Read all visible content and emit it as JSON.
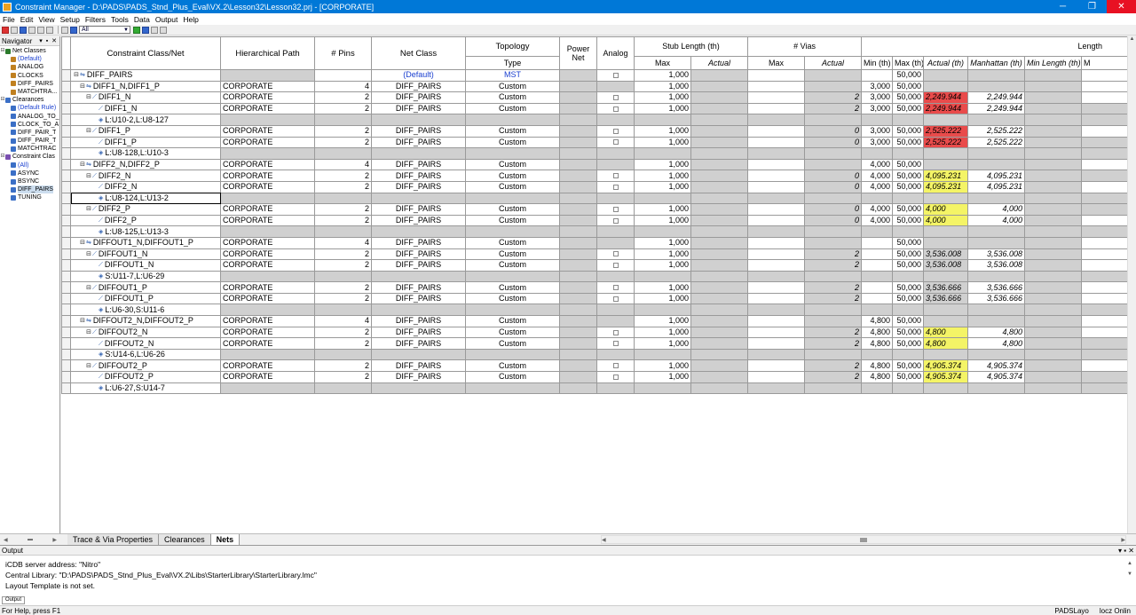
{
  "window": {
    "title": "Constraint Manager - D:\\PADS\\PADS_Stnd_Plus_Eval\\VX.2\\Lesson32\\Lesson32.prj - [CORPORATE]",
    "minimize": "─",
    "maximize": "❐",
    "close": "✕"
  },
  "menu": [
    "File",
    "Edit",
    "View",
    "Setup",
    "Filters",
    "Tools",
    "Data",
    "Output",
    "Help"
  ],
  "toolbar": {
    "filter_value": "All"
  },
  "navigator": {
    "title": "Navigator",
    "pin": "▾ ▪ ✕",
    "items": [
      {
        "label": "Net Classes",
        "level": 0,
        "exp": "⊟",
        "color": "#2b7a2b"
      },
      {
        "label": "(Default)",
        "level": 1,
        "exp": "",
        "color": "#c08020",
        "blue": true
      },
      {
        "label": "ANALOG",
        "level": 1,
        "exp": "",
        "color": "#c08020"
      },
      {
        "label": "CLOCKS",
        "level": 1,
        "exp": "",
        "color": "#c08020"
      },
      {
        "label": "DIFF_PAIRS",
        "level": 1,
        "exp": "",
        "color": "#c08020"
      },
      {
        "label": "MATCHTRA...",
        "level": 1,
        "exp": "",
        "color": "#c08020"
      },
      {
        "label": "Clearances",
        "level": 0,
        "exp": "⊟",
        "color": "#3b6fc6"
      },
      {
        "label": "(Default Rule)",
        "level": 1,
        "exp": "",
        "color": "#3b6fc6",
        "blue": true
      },
      {
        "label": "ANALOG_TO_",
        "level": 1,
        "exp": "",
        "color": "#3b6fc6"
      },
      {
        "label": "CLOCK_TO_A",
        "level": 1,
        "exp": "",
        "color": "#3b6fc6"
      },
      {
        "label": "DIFF_PAIR_T",
        "level": 1,
        "exp": "",
        "color": "#3b6fc6"
      },
      {
        "label": "DIFF_PAIR_T",
        "level": 1,
        "exp": "",
        "color": "#3b6fc6"
      },
      {
        "label": "MATCHTRAC",
        "level": 1,
        "exp": "",
        "color": "#3b6fc6"
      },
      {
        "label": "Constraint Clas",
        "level": 0,
        "exp": "⊟",
        "color": "#7a4fb0"
      },
      {
        "label": "(All)",
        "level": 1,
        "exp": "",
        "color": "#3b6fc6",
        "blue": true
      },
      {
        "label": "ASYNC",
        "level": 1,
        "exp": "",
        "color": "#3b6fc6"
      },
      {
        "label": "BSYNC",
        "level": 1,
        "exp": "",
        "color": "#3b6fc6"
      },
      {
        "label": "DIFF_PAIRS",
        "level": 1,
        "exp": "",
        "color": "#3b6fc6",
        "sel": true
      },
      {
        "label": "TUNING",
        "level": 1,
        "exp": "",
        "color": "#3b6fc6"
      }
    ]
  },
  "headers": {
    "name": "Constraint Class/Net",
    "hier": "Hierarchical Path",
    "pins": "# Pins",
    "netclass": "Net Class",
    "topology": "Topology",
    "type": "Type",
    "power": "Power Net",
    "analog": "Analog",
    "stub": "Stub Length (th)",
    "stub_max": "Max",
    "stub_actual": "Actual",
    "vias": "# Vias",
    "vias_max": "Max",
    "vias_actual": "Actual",
    "length": "Length",
    "len_min": "Min (th)",
    "len_max": "Max (th)",
    "len_actual": "Actual (th)",
    "len_manhattan": "Manhattan (th)",
    "len_minlen": "Min Length (th)",
    "len_more": "M"
  },
  "rows": [
    {
      "name": "DIFF_PAIRS",
      "indent": 0,
      "exp": "⊟",
      "icon": "⇋",
      "kind": "class",
      "hier": "",
      "pins": "",
      "netclass": "(Default)",
      "type": "MST",
      "analog": false,
      "stub": "1,000",
      "vact": "",
      "min": "",
      "max": "50,000",
      "actual": "",
      "man": "",
      "status": ""
    },
    {
      "name": "DIFF1_N,DIFF1_P",
      "indent": 1,
      "exp": "⊟",
      "icon": "⇋",
      "kind": "pair",
      "hier": "CORPORATE",
      "pins": "4",
      "netclass": "DIFF_PAIRS",
      "type": "Custom",
      "analog": null,
      "stub": "1,000",
      "vact": "",
      "min": "3,000",
      "max": "50,000",
      "actual": "",
      "man": "",
      "status": ""
    },
    {
      "name": "DIFF1_N",
      "indent": 2,
      "exp": "⊟",
      "icon": "⟋",
      "kind": "net",
      "hier": "CORPORATE",
      "pins": "2",
      "netclass": "DIFF_PAIRS",
      "type": "Custom",
      "analog": false,
      "stub": "1,000",
      "vact": "2",
      "min": "3,000",
      "max": "50,000",
      "actual": "2,249.944",
      "man": "2,249.944",
      "status": "fail"
    },
    {
      "name": "DIFF1_N",
      "indent": 3,
      "exp": "",
      "icon": "⟋",
      "kind": "net",
      "hier": "CORPORATE",
      "pins": "2",
      "netclass": "DIFF_PAIRS",
      "type": "Custom",
      "analog": false,
      "stub": "1,000",
      "vact": "2",
      "min": "3,000",
      "max": "50,000",
      "actual": "2,249.944",
      "man": "2,249.944",
      "status": "fail"
    },
    {
      "name": "L:U10-2,L:U8-127",
      "indent": 3,
      "exp": "",
      "icon": "◈",
      "kind": "pinpair"
    },
    {
      "name": "DIFF1_P",
      "indent": 2,
      "exp": "⊟",
      "icon": "⟋",
      "kind": "net",
      "hier": "CORPORATE",
      "pins": "2",
      "netclass": "DIFF_PAIRS",
      "type": "Custom",
      "analog": false,
      "stub": "1,000",
      "vact": "0",
      "min": "3,000",
      "max": "50,000",
      "actual": "2,525.222",
      "man": "2,525.222",
      "status": "fail"
    },
    {
      "name": "DIFF1_P",
      "indent": 3,
      "exp": "",
      "icon": "⟋",
      "kind": "net",
      "hier": "CORPORATE",
      "pins": "2",
      "netclass": "DIFF_PAIRS",
      "type": "Custom",
      "analog": false,
      "stub": "1,000",
      "vact": "0",
      "min": "3,000",
      "max": "50,000",
      "actual": "2,525.222",
      "man": "2,525.222",
      "status": "fail"
    },
    {
      "name": "L:U8-128,L:U10-3",
      "indent": 3,
      "exp": "",
      "icon": "◈",
      "kind": "pinpair"
    },
    {
      "name": "DIFF2_N,DIFF2_P",
      "indent": 1,
      "exp": "⊟",
      "icon": "⇋",
      "kind": "pair",
      "hier": "CORPORATE",
      "pins": "4",
      "netclass": "DIFF_PAIRS",
      "type": "Custom",
      "analog": null,
      "stub": "1,000",
      "vact": "",
      "min": "4,000",
      "max": "50,000",
      "actual": "",
      "man": "",
      "status": ""
    },
    {
      "name": "DIFF2_N",
      "indent": 2,
      "exp": "⊟",
      "icon": "⟋",
      "kind": "net",
      "hier": "CORPORATE",
      "pins": "2",
      "netclass": "DIFF_PAIRS",
      "type": "Custom",
      "analog": false,
      "stub": "1,000",
      "vact": "0",
      "min": "4,000",
      "max": "50,000",
      "actual": "4,095.231",
      "man": "4,095.231",
      "status": "warn"
    },
    {
      "name": "DIFF2_N",
      "indent": 3,
      "exp": "",
      "icon": "⟋",
      "kind": "net",
      "hier": "CORPORATE",
      "pins": "2",
      "netclass": "DIFF_PAIRS",
      "type": "Custom",
      "analog": false,
      "stub": "1,000",
      "vact": "0",
      "min": "4,000",
      "max": "50,000",
      "actual": "4,095.231",
      "man": "4,095.231",
      "status": "warn"
    },
    {
      "name": "L:U8-124,L:U13-2",
      "indent": 3,
      "exp": "",
      "icon": "◈",
      "kind": "pinpair",
      "selected": true
    },
    {
      "name": "DIFF2_P",
      "indent": 2,
      "exp": "⊟",
      "icon": "⟋",
      "kind": "net",
      "hier": "CORPORATE",
      "pins": "2",
      "netclass": "DIFF_PAIRS",
      "type": "Custom",
      "analog": false,
      "stub": "1,000",
      "vact": "0",
      "min": "4,000",
      "max": "50,000",
      "actual": "4,000",
      "man": "4,000",
      "status": "warn"
    },
    {
      "name": "DIFF2_P",
      "indent": 3,
      "exp": "",
      "icon": "⟋",
      "kind": "net",
      "hier": "CORPORATE",
      "pins": "2",
      "netclass": "DIFF_PAIRS",
      "type": "Custom",
      "analog": false,
      "stub": "1,000",
      "vact": "0",
      "min": "4,000",
      "max": "50,000",
      "actual": "4,000",
      "man": "4,000",
      "status": "warn"
    },
    {
      "name": "L:U8-125,L:U13-3",
      "indent": 3,
      "exp": "",
      "icon": "◈",
      "kind": "pinpair"
    },
    {
      "name": "DIFFOUT1_N,DIFFOUT1_P",
      "indent": 1,
      "exp": "⊟",
      "icon": "⇋",
      "kind": "pair",
      "hier": "CORPORATE",
      "pins": "4",
      "netclass": "DIFF_PAIRS",
      "type": "Custom",
      "analog": null,
      "stub": "1,000",
      "vact": "",
      "min": "",
      "max": "50,000",
      "actual": "",
      "man": "",
      "status": ""
    },
    {
      "name": "DIFFOUT1_N",
      "indent": 2,
      "exp": "⊟",
      "icon": "⟋",
      "kind": "net",
      "hier": "CORPORATE",
      "pins": "2",
      "netclass": "DIFF_PAIRS",
      "type": "Custom",
      "analog": false,
      "stub": "1,000",
      "vact": "2",
      "min": "",
      "max": "50,000",
      "actual": "3,536.008",
      "man": "3,536.008",
      "status": "plain"
    },
    {
      "name": "DIFFOUT1_N",
      "indent": 3,
      "exp": "",
      "icon": "⟋",
      "kind": "net",
      "hier": "CORPORATE",
      "pins": "2",
      "netclass": "DIFF_PAIRS",
      "type": "Custom",
      "analog": false,
      "stub": "1,000",
      "vact": "2",
      "min": "",
      "max": "50,000",
      "actual": "3,536.008",
      "man": "3,536.008",
      "status": "plain"
    },
    {
      "name": "S:U11-7,L:U6-29",
      "indent": 3,
      "exp": "",
      "icon": "◈",
      "kind": "pinpair"
    },
    {
      "name": "DIFFOUT1_P",
      "indent": 2,
      "exp": "⊟",
      "icon": "⟋",
      "kind": "net",
      "hier": "CORPORATE",
      "pins": "2",
      "netclass": "DIFF_PAIRS",
      "type": "Custom",
      "analog": false,
      "stub": "1,000",
      "vact": "2",
      "min": "",
      "max": "50,000",
      "actual": "3,536.666",
      "man": "3,536.666",
      "status": "plain"
    },
    {
      "name": "DIFFOUT1_P",
      "indent": 3,
      "exp": "",
      "icon": "⟋",
      "kind": "net",
      "hier": "CORPORATE",
      "pins": "2",
      "netclass": "DIFF_PAIRS",
      "type": "Custom",
      "analog": false,
      "stub": "1,000",
      "vact": "2",
      "min": "",
      "max": "50,000",
      "actual": "3,536.666",
      "man": "3,536.666",
      "status": "plain"
    },
    {
      "name": "L:U6-30,S:U11-6",
      "indent": 3,
      "exp": "",
      "icon": "◈",
      "kind": "pinpair"
    },
    {
      "name": "DIFFOUT2_N,DIFFOUT2_P",
      "indent": 1,
      "exp": "⊟",
      "icon": "⇋",
      "kind": "pair",
      "hier": "CORPORATE",
      "pins": "4",
      "netclass": "DIFF_PAIRS",
      "type": "Custom",
      "analog": null,
      "stub": "1,000",
      "vact": "",
      "min": "4,800",
      "max": "50,000",
      "actual": "",
      "man": "",
      "status": ""
    },
    {
      "name": "DIFFOUT2_N",
      "indent": 2,
      "exp": "⊟",
      "icon": "⟋",
      "kind": "net",
      "hier": "CORPORATE",
      "pins": "2",
      "netclass": "DIFF_PAIRS",
      "type": "Custom",
      "analog": false,
      "stub": "1,000",
      "vact": "2",
      "min": "4,800",
      "max": "50,000",
      "actual": "4,800",
      "man": "4,800",
      "status": "warn"
    },
    {
      "name": "DIFFOUT2_N",
      "indent": 3,
      "exp": "",
      "icon": "⟋",
      "kind": "net",
      "hier": "CORPORATE",
      "pins": "2",
      "netclass": "DIFF_PAIRS",
      "type": "Custom",
      "analog": false,
      "stub": "1,000",
      "vact": "2",
      "min": "4,800",
      "max": "50,000",
      "actual": "4,800",
      "man": "4,800",
      "status": "warn"
    },
    {
      "name": "S:U14-6,L:U6-26",
      "indent": 3,
      "exp": "",
      "icon": "◈",
      "kind": "pinpair"
    },
    {
      "name": "DIFFOUT2_P",
      "indent": 2,
      "exp": "⊟",
      "icon": "⟋",
      "kind": "net",
      "hier": "CORPORATE",
      "pins": "2",
      "netclass": "DIFF_PAIRS",
      "type": "Custom",
      "analog": false,
      "stub": "1,000",
      "vact": "2",
      "min": "4,800",
      "max": "50,000",
      "actual": "4,905.374",
      "man": "4,905.374",
      "status": "warn"
    },
    {
      "name": "DIFFOUT2_P",
      "indent": 3,
      "exp": "",
      "icon": "⟋",
      "kind": "net",
      "hier": "CORPORATE",
      "pins": "2",
      "netclass": "DIFF_PAIRS",
      "type": "Custom",
      "analog": false,
      "stub": "1,000",
      "vact": "2",
      "min": "4,800",
      "max": "50,000",
      "actual": "4,905.374",
      "man": "4,905.374",
      "status": "warn"
    },
    {
      "name": "L:U6-27,S:U14-7",
      "indent": 3,
      "exp": "",
      "icon": "◈",
      "kind": "pinpair"
    }
  ],
  "colors": {
    "fail": "#e94b4b",
    "warn": "#f4f466",
    "link": "#1a3fcf"
  },
  "tabs": [
    {
      "label": "Trace & Via Properties",
      "active": false
    },
    {
      "label": "Clearances",
      "active": false
    },
    {
      "label": "Nets",
      "active": true
    }
  ],
  "output": {
    "title": "Output",
    "pin": "▾ ▪ ✕",
    "lines": [
      "iCDB server address: \"Nitro\"",
      "Central Library: \"D:\\PADS\\PADS_Stnd_Plus_Eval\\VX.2\\Libs\\StarterLibrary\\StarterLibrary.lmc\"",
      "Layout Template is not set."
    ],
    "tab": "Output"
  },
  "status": {
    "hint": "For Help, press F1",
    "app": "PADSLayo",
    "mode": "locz Onlin"
  }
}
